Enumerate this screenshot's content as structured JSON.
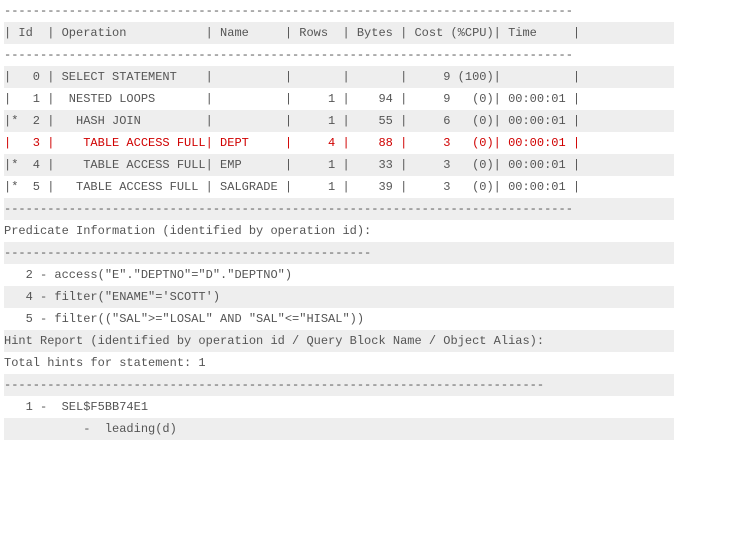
{
  "plan_separator": "-------------------------------------------------------------------------------",
  "header_line": "| Id  | Operation           | Name     | Rows  | Bytes | Cost (%CPU)| Time     |",
  "plan_rows": [
    "|   0 | SELECT STATEMENT    |          |       |       |     9 (100)|          |",
    "|   1 |  NESTED LOOPS       |          |     1 |    94 |     9   (0)| 00:00:01 |",
    "|*  2 |   HASH JOIN         |          |     1 |    55 |     6   (0)| 00:00:01 |",
    "|   3 |    TABLE ACCESS FULL| DEPT     |     4 |    88 |     3   (0)| 00:00:01 |",
    "|*  4 |    TABLE ACCESS FULL| EMP      |     1 |    33 |     3   (0)| 00:00:01 |",
    "|*  5 |   TABLE ACCESS FULL | SALGRADE |     1 |    39 |     3   (0)| 00:00:01 |"
  ],
  "plan_highlight_index": 3,
  "predicate_heading": "Predicate Information (identified by operation id):",
  "short_separator": "---------------------------------------------------",
  "predicate_lines": [
    "   2 - access(\"E\".\"DEPTNO\"=\"D\".\"DEPTNO\")",
    "   4 - filter(\"ENAME\"='SCOTT')",
    "   5 - filter((\"SAL\">=\"LOSAL\" AND \"SAL\"<=\"HISAL\"))"
  ],
  "hint_heading_1": "Hint Report (identified by operation id / Query Block Name / Object Alias):",
  "hint_heading_2": "Total hints for statement: 1",
  "hint_separator": "---------------------------------------------------------------------------",
  "hint_lines": [
    "   1 -  SEL$F5BB74E1",
    "           -  leading(d)"
  ]
}
